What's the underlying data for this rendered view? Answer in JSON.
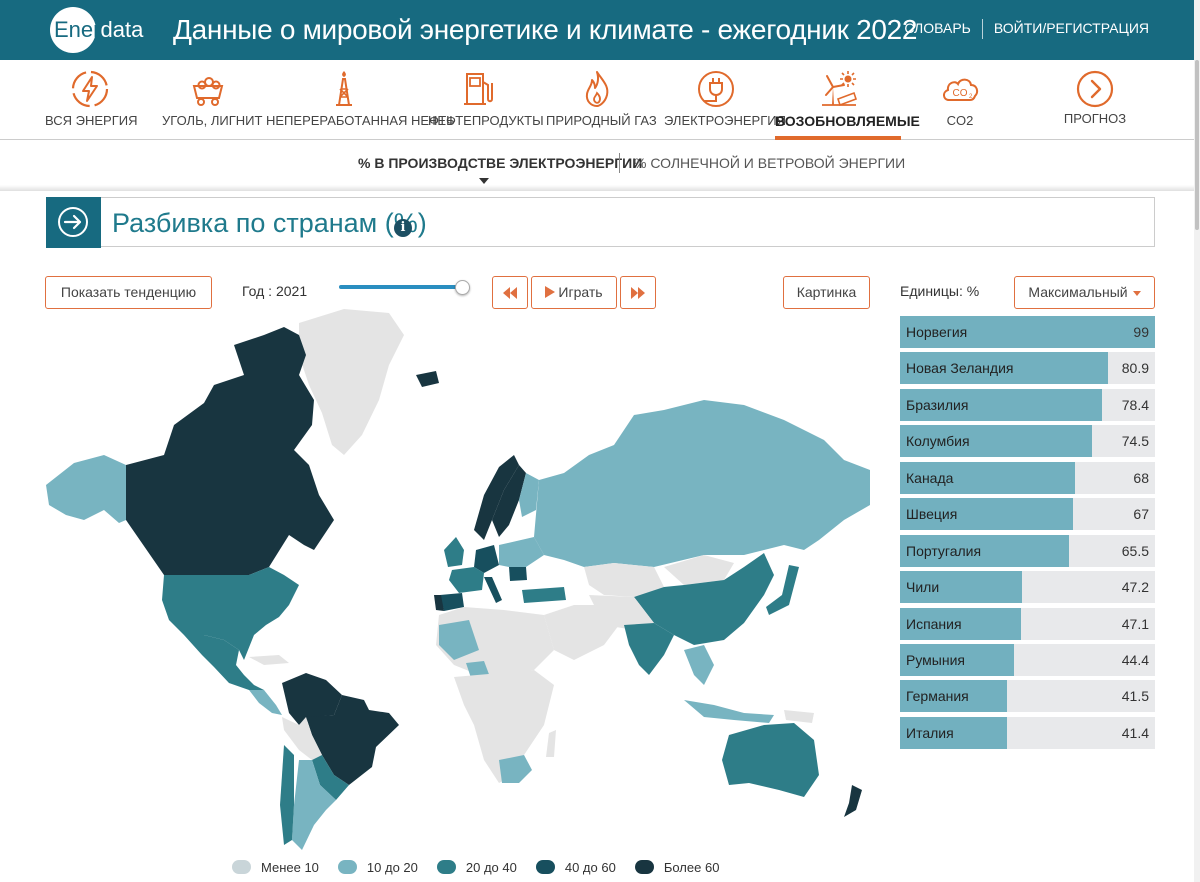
{
  "header": {
    "logo_text_a": "Ener",
    "logo_text_b": "data",
    "title": "Данные о мировой энергетике и климате - ежегодник 2022",
    "links": [
      "СЛОВАРЬ",
      "ВОЙТИ/РЕГИСТРАЦИЯ"
    ]
  },
  "categories": [
    {
      "label": "ВСЯ ЭНЕРГИЯ",
      "icon": "lightning-icon"
    },
    {
      "label": "УГОЛЬ, ЛИГНИТ",
      "icon": "coal-cart-icon"
    },
    {
      "label": "НЕПЕРЕРАБОТАННАЯ НЕФТЬ",
      "icon": "oil-derrick-icon"
    },
    {
      "label": "НЕФТЕПРОДУКТЫ",
      "icon": "fuel-pump-icon"
    },
    {
      "label": "ПРИРОДНЫЙ ГАЗ",
      "icon": "flame-icon"
    },
    {
      "label": "ЭЛЕКТРОЭНЕРГИЯ",
      "icon": "plug-icon"
    },
    {
      "label": "ВОЗОБНОВЛЯЕМЫЕ",
      "icon": "renewables-icon"
    },
    {
      "label": "CO2",
      "icon": "co2-cloud-icon"
    },
    {
      "label": "ПРОГНОЗ",
      "icon": "chevron-right-circle-icon"
    }
  ],
  "active_category": "ВОЗОБНОВЛЯЕМЫЕ",
  "subnav": {
    "tab1": "% В ПРОИЗВОДСТВЕ ЭЛЕКТРОЭНЕРГИИ",
    "tab2": "% СОЛНЕЧНОЙ И ВЕТРОВОЙ ЭНЕРГИИ"
  },
  "section": {
    "title": "Разбивка по странам (%)",
    "info_glyph": "i"
  },
  "controls": {
    "trend_button": "Показать тенденцию",
    "year_label": "Год : 2021",
    "year_fraction": 1.0,
    "play_label": "Играть",
    "picture_button": "Картинка",
    "units_label": "Единицы: %",
    "sort_select": "Максимальный"
  },
  "ranking": [
    {
      "country": "Норвегия",
      "value": 99
    },
    {
      "country": "Новая Зеландия",
      "value": 80.9
    },
    {
      "country": "Бразилия",
      "value": 78.4
    },
    {
      "country": "Колумбия",
      "value": 74.5
    },
    {
      "country": "Канада",
      "value": 68
    },
    {
      "country": "Швеция",
      "value": 67
    },
    {
      "country": "Португалия",
      "value": 65.5
    },
    {
      "country": "Чили",
      "value": 47.2
    },
    {
      "country": "Испания",
      "value": 47.1
    },
    {
      "country": "Румыния",
      "value": 44.4
    },
    {
      "country": "Германия",
      "value": 41.5
    },
    {
      "country": "Италия",
      "value": 41.4
    }
  ],
  "legend": [
    {
      "label": "Менее 10",
      "color": "#c9d5d9"
    },
    {
      "label": "10 до 20",
      "color": "#78b4c1"
    },
    {
      "label": "20 до 40",
      "color": "#2e7d88"
    },
    {
      "label": "40 до 60",
      "color": "#174f5e"
    },
    {
      "label": "Более 60",
      "color": "#183540"
    }
  ],
  "colors": {
    "brand": "#176a80",
    "accent": "#e06a2c",
    "bar": "#72b0bf",
    "bar_track": "#e8e9eb",
    "no_data": "#e4e4e4"
  }
}
